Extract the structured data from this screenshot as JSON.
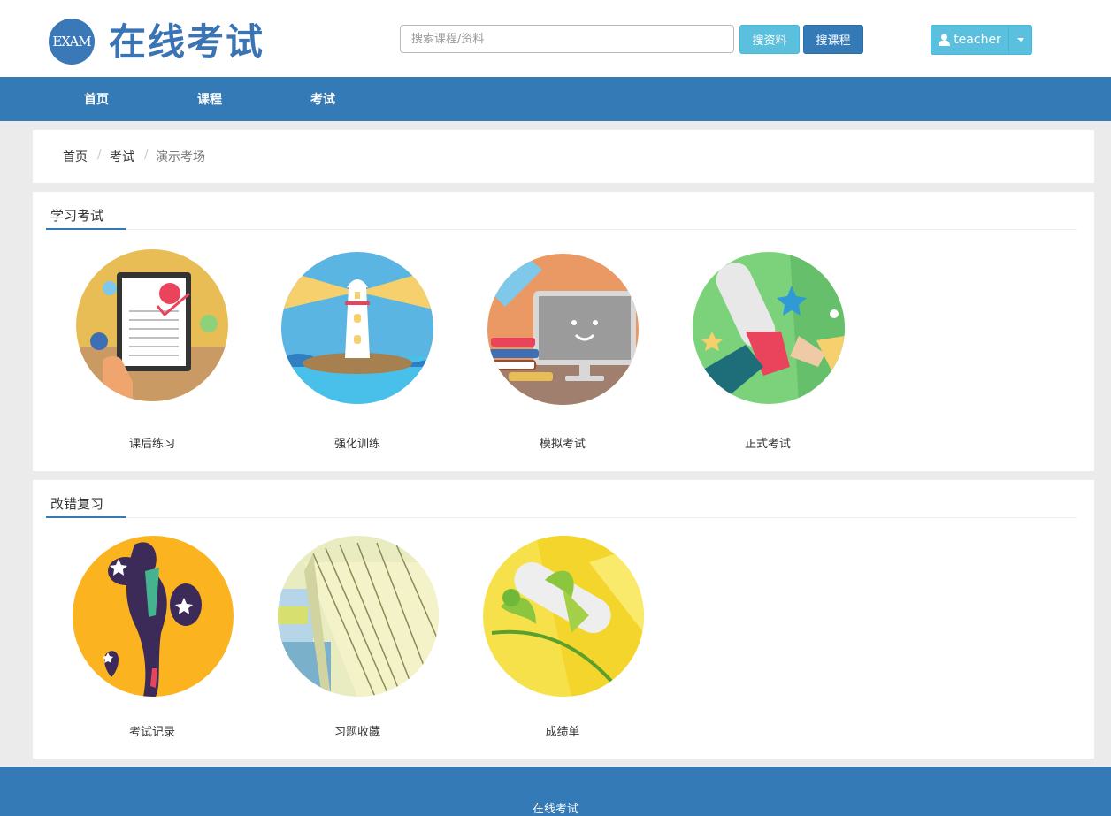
{
  "header": {
    "logo_badge": "EXAM",
    "logo_title": "在线考试",
    "search_placeholder": "搜索课程/资料",
    "search_materials_label": "搜资料",
    "search_courses_label": "搜课程",
    "user_name": "teacher"
  },
  "nav": {
    "items": [
      "首页",
      "课程",
      "考试"
    ]
  },
  "breadcrumb": {
    "items": [
      "首页",
      "考试",
      "演示考场"
    ],
    "separator": "/"
  },
  "sections": [
    {
      "title": "学习考试",
      "tiles": [
        "课后练习",
        "强化训练",
        "模拟考试",
        "正式考试"
      ]
    },
    {
      "title": "改错复习",
      "tiles": [
        "考试记录",
        "习题收藏",
        "成绩单"
      ]
    }
  ],
  "footer": {
    "text": "在线考试"
  },
  "colors": {
    "primary": "#337ab7",
    "info": "#5bc0de",
    "logo_text": "#3b74b4",
    "background": "#ebebeb"
  }
}
